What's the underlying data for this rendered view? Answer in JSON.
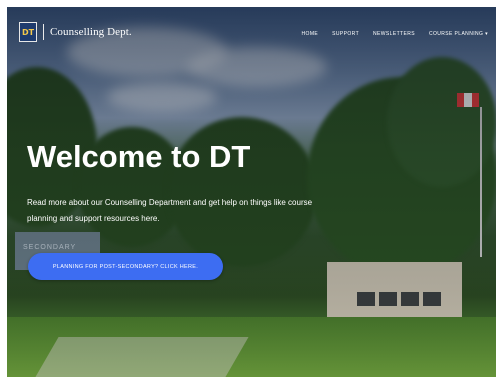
{
  "nav": {
    "brand_name": "Counselling Dept.",
    "links": [
      "HOME",
      "SUPPORT",
      "NEWSLETTERS",
      "COURSE PLANNING ▾"
    ]
  },
  "hero": {
    "title": "Welcome to DT",
    "subtitle": "Read more about our Counselling Department and get help on things like course planning and support resources here.",
    "cta_label": "PLANNING FOR POST-SECONDARY? CLICK HERE."
  },
  "colors": {
    "cta": "#3d6df2",
    "text": "#ffffff"
  }
}
